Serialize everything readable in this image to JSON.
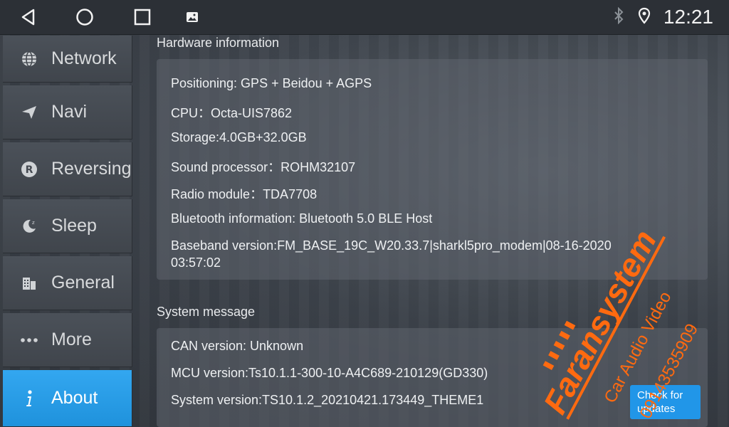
{
  "statusbar": {
    "time": "12:21",
    "icons": [
      "back-icon",
      "home-icon",
      "recents-icon",
      "gallery-icon",
      "bluetooth-icon",
      "location-icon"
    ]
  },
  "sidebar": {
    "items": [
      {
        "label": "Network",
        "icon": "globe-icon"
      },
      {
        "label": "Navi",
        "icon": "paper-plane-icon"
      },
      {
        "label": "Reversing",
        "icon": "reverse-r-icon"
      },
      {
        "label": "Sleep",
        "icon": "moon-sleep-icon"
      },
      {
        "label": "General",
        "icon": "building-icon"
      },
      {
        "label": "More",
        "icon": "dots-icon"
      },
      {
        "label": "About",
        "icon": "info-icon",
        "active": true
      }
    ],
    "active_color": "#2a9de8"
  },
  "hardware": {
    "title": "Hardware information",
    "rows": [
      "Positioning: GPS + Beidou + AGPS",
      "CPU：Octa-UIS7862",
      "Storage:4.0GB+32.0GB",
      "Sound processor：ROHM32107",
      "Radio module：TDA7708",
      "Bluetooth information: Bluetooth 5.0 BLE Host",
      "Baseband version:FM_BASE_19C_W20.33.7|sharkl5pro_modem|08-16-2020",
      "03:57:02"
    ]
  },
  "system": {
    "title": "System message",
    "rows": [
      "CAN version: Unknown",
      "MCU version:Ts10.1.1-300-10-A4C689-210129(GD330)",
      "System version:TS10.1.2_20210421.173449_THEME1"
    ],
    "check_line1": "Check for",
    "check_line2": "updates"
  },
  "watermark": {
    "brand": "Faransystem",
    "line1": "Car Audio Video",
    "line2": "09143535909",
    "color": "#ff6a10"
  }
}
